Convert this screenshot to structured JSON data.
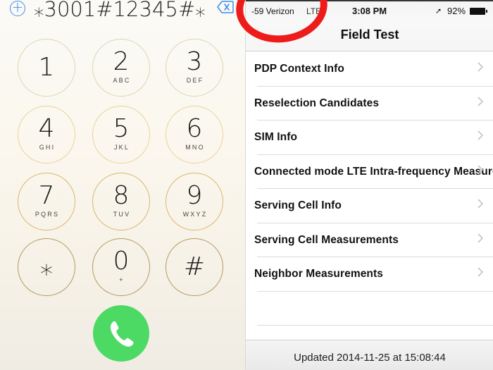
{
  "dialer": {
    "add_contact_icon": "plus-circle-icon",
    "dialed_number": "⁎3001#12345#⁎",
    "backspace_icon": "delete-left-icon",
    "keys": [
      {
        "digit": "1",
        "letters": ""
      },
      {
        "digit": "2",
        "letters": "ABC"
      },
      {
        "digit": "3",
        "letters": "DEF"
      },
      {
        "digit": "4",
        "letters": "GHI"
      },
      {
        "digit": "5",
        "letters": "JKL"
      },
      {
        "digit": "6",
        "letters": "MNO"
      },
      {
        "digit": "7",
        "letters": "PQRS"
      },
      {
        "digit": "8",
        "letters": "TUV"
      },
      {
        "digit": "9",
        "letters": "WXYZ"
      },
      {
        "digit": "⁎",
        "letters": ""
      },
      {
        "digit": "0",
        "letters": "+"
      },
      {
        "digit": "#",
        "letters": ""
      }
    ],
    "call_icon": "phone-icon",
    "call_color": "#4cd964"
  },
  "status_bar": {
    "carrier": "-59 Verizon",
    "network": "LTE",
    "time": "3:08 PM",
    "location_icon": "location-arrow-icon",
    "battery": "92%",
    "battery_icon": "battery-icon"
  },
  "field_test": {
    "title": "Field Test",
    "items": [
      {
        "label": "PDP Context Info"
      },
      {
        "label": "Reselection Candidates"
      },
      {
        "label": "SIM Info"
      },
      {
        "label": "Connected mode LTE Intra-frequency Measurements"
      },
      {
        "label": "Serving Cell Info"
      },
      {
        "label": "Serving Cell Measurements"
      },
      {
        "label": "Neighbor Measurements"
      }
    ],
    "updated": "Updated 2014-11-25 at 15:08:44"
  },
  "annotation": {
    "highlight_color": "#ee1b1b"
  }
}
